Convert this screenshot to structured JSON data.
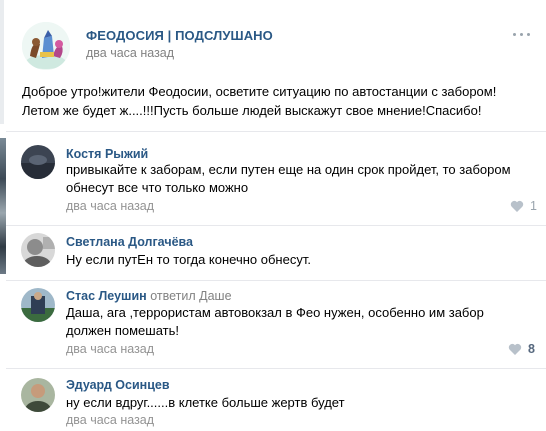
{
  "post": {
    "title": "ФЕОДОСИЯ | ПОДСЛУШАНО",
    "time": "два часа назад",
    "text_line1": "Доброе утро!жители Феодосии, осветите ситуацию по автостанции с забором!",
    "text_line2": "Летом же будет ж....!!!Пусть больше людей выскажут свое мнение!Спасибо!"
  },
  "comments": [
    {
      "author": "Костя Рыжий",
      "text_line1": "привыкайте к заборам, если путен еще на один срок пройдет, то забором",
      "text_line2": "обнесут все что только можно",
      "time": "два часа назад",
      "likes": "1"
    },
    {
      "author": "Светлана Долгачёва",
      "text_line1": "Ну если путЕн то тогда конечно обнесут."
    },
    {
      "author": "Стас Леушин",
      "reply_word": "ответил",
      "reply_to": "Даше",
      "text_line1": "Даша, ага ,террористам автовокзал в Фео нужен, особенно им забор",
      "text_line2": "должен помешать!",
      "time": "два часа назад",
      "likes": "8"
    },
    {
      "author": "Эдуард Осинцев",
      "text_line1": "ну если вдруг......в клетке больше жертв будет",
      "time": "два часа назад"
    }
  ],
  "colors": {
    "link": "#2a5885",
    "meta": "#828282",
    "divider": "#e7e8ec",
    "like_icon": "#9aa4ad"
  },
  "icons": [
    "more-icon",
    "heart-icon"
  ]
}
